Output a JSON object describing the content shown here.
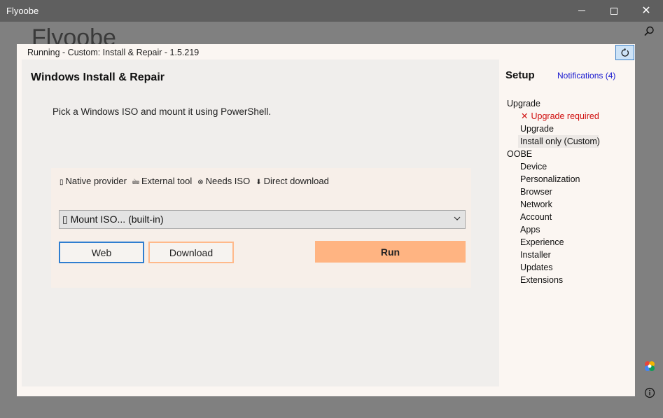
{
  "window": {
    "title": "Flyoobe",
    "minimize_glyph": "—",
    "maximize_glyph": "□",
    "close_glyph": "✕"
  },
  "background": {
    "app_name": "Flyoobe"
  },
  "dialog": {
    "status": "Running - Custom: Install & Repair - 1.5.219",
    "refresh_icon": "refresh-icon"
  },
  "main": {
    "title": "Windows Install & Repair",
    "description": "Pick a Windows ISO and mount it using PowerShell.",
    "legend": {
      "native_icon": "▯",
      "native": "Native provider",
      "external_icon": "🖮",
      "external": "External tool",
      "iso_icon": "⊗",
      "iso": "Needs ISO",
      "download_icon": "⬇",
      "download": "Direct download"
    },
    "dropdown": {
      "selected": "▯ Mount ISO... (built-in)"
    },
    "buttons": {
      "web": "Web",
      "download": "Download",
      "run": "Run"
    }
  },
  "sidebar": {
    "title": "Setup",
    "notifications": "Notifications (4)",
    "upgrade_group": "Upgrade",
    "upgrade_required": "Upgrade required",
    "upgrade_required_icon": "✕",
    "upgrade": "Upgrade",
    "install_only": "Install only (Custom)",
    "oobe_group": "OOBE",
    "oobe_items": [
      "Device",
      "Personalization",
      "Browser",
      "Network",
      "Account",
      "Apps",
      "Experience",
      "Installer",
      "Updates",
      "Extensions"
    ]
  },
  "colors": {
    "accent_blue": "#2f7ed0",
    "run_orange": "#ffb482",
    "error_red": "#d01010",
    "link_blue": "#1a1ad0"
  }
}
